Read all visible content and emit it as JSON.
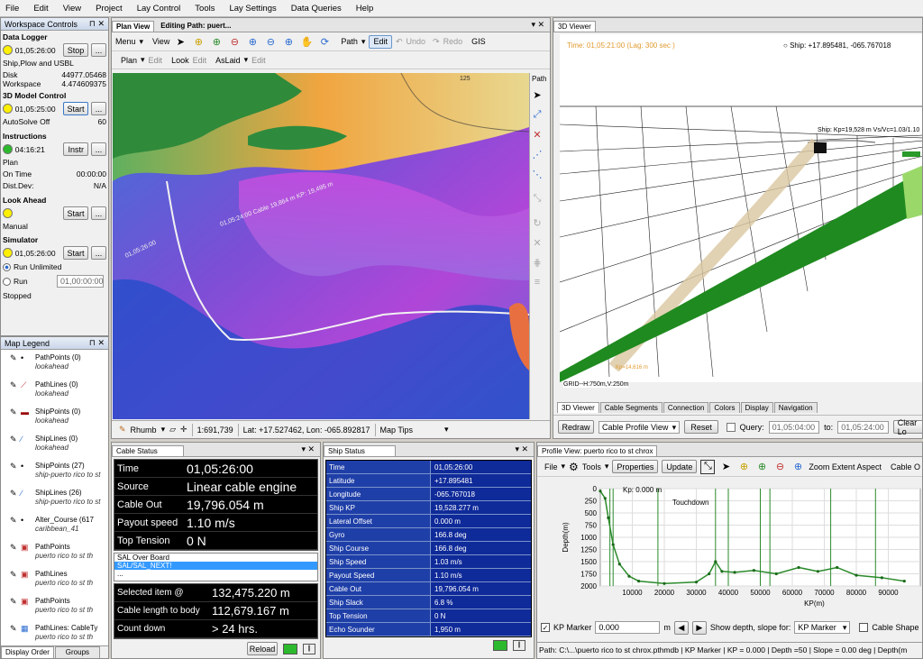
{
  "menu": [
    "File",
    "Edit",
    "View",
    "Project",
    "Lay Control",
    "Tools",
    "Lay Settings",
    "Data Queries",
    "Help"
  ],
  "workspace": {
    "title": "Workspace Controls",
    "data_logger": {
      "title": "Data Logger",
      "time": "01,05:26:00",
      "btn": "Stop",
      "sub": "Ship,Plow and USBL",
      "disk_label": "Disk",
      "disk_value": "44977.05468",
      "ws_label": "Workspace",
      "ws_value": "4.474609375"
    },
    "model": {
      "title": "3D Model Control",
      "time": "01,05:25:00",
      "btn": "Start",
      "autosolve": "AutoSolve Off",
      "autosolve_value": "60"
    },
    "instructions": {
      "title": "Instructions",
      "time": "04:16:21",
      "btn": "Instr",
      "plan": "Plan",
      "ontime": "On Time",
      "ontime_value": "00:00:00",
      "distdev": "Dist.Dev:",
      "distdev_value": "N/A"
    },
    "lookahead": {
      "title": "Look Ahead",
      "btn": "Start",
      "mode": "Manual"
    },
    "simulator": {
      "title": "Simulator",
      "time": "01,05:26:00",
      "btn": "Start",
      "run_unlimited": "Run Unlimited",
      "run": "Run",
      "run_value": "01,00:00:00",
      "status": "Stopped"
    },
    "more": "..."
  },
  "legend": {
    "title": "Map Legend",
    "items": [
      {
        "name": "PathPoints (0)",
        "sub": "lookahead"
      },
      {
        "name": "PathLines (0)",
        "sub": "lookahead"
      },
      {
        "name": "ShipPoints (0)",
        "sub": "lookahead"
      },
      {
        "name": "ShipLines (0)",
        "sub": "lookahead"
      },
      {
        "name": "ShipPoints (27)",
        "sub": "ship-puerto rico to st"
      },
      {
        "name": "ShipLines (26)",
        "sub": "ship-puerto rico to st"
      },
      {
        "name": "Alter_Course (617",
        "sub": "caribbean_41"
      },
      {
        "name": "PathPoints",
        "sub": "puerto rico to st th"
      },
      {
        "name": "PathLines",
        "sub": "puerto rico to st th"
      },
      {
        "name": "PathPoints",
        "sub": "puerto rico to st th"
      },
      {
        "name": "PathLines: CableTy",
        "sub": "puerto rico to st th"
      }
    ],
    "tab1": "Display Order",
    "tab2": "Groups"
  },
  "plan": {
    "tab": "Plan View",
    "editing": "Editing Path: puert...",
    "menu": "Menu",
    "view": "View",
    "path": "Path",
    "edit": "Edit",
    "undo": "Undo",
    "redo": "Redo",
    "gis": "GIS",
    "plan2": "Plan",
    "edit2": "Edit",
    "look": "Look",
    "edit3": "Edit",
    "aslaid": "AsLaid",
    "edit4": "Edit",
    "side": "Path",
    "rhumb": "Rhumb",
    "scale": "1:691,739",
    "latlon": "Lat: +17.527462, Lon: -065.892817",
    "maptips": "Map Tips",
    "label1": "01,05:24:00 Cable 19,864 m KP: 19,495 m",
    "label2": "01,05:26:00",
    "label3": "125"
  },
  "viewer": {
    "tab": "3D Viewer",
    "time": "Time: 01,05:21:00  (Lag: 300 sec )",
    "ship": "Ship: +17.895481, -065.767018",
    "shiplabel": "Ship: Kp=19,528 m Vs/Vc=1.03/1.10",
    "kp": "Kp=14,616 m",
    "grid": "GRID--H:750m,V:250m",
    "tabs": [
      "3D Viewer",
      "Cable Segments",
      "Connection",
      "Colors",
      "Display",
      "Navigation"
    ],
    "redraw": "Redraw",
    "profile": "Cable Profile View",
    "reset": "Reset",
    "query": "Query:",
    "from": "01,05:04:00",
    "to_label": "to:",
    "to": "01,05:24:00",
    "clear": "Clear Lo"
  },
  "cable": {
    "title": "Cable Status",
    "rows": [
      {
        "k": "Time",
        "v": "01,05:26:00"
      },
      {
        "k": "Source",
        "v": "Linear cable engine"
      },
      {
        "k": "Cable Out",
        "v": "19,796.054 m"
      },
      {
        "k": "Payout speed",
        "v": "1.10 m/s"
      },
      {
        "k": "Top Tension",
        "v": "0 N"
      }
    ],
    "list": [
      "SAL Over Board",
      "SAL/SAL_NEXT!",
      "..."
    ],
    "rows2": [
      {
        "k": "Selected item @",
        "v": "132,475.220 m"
      },
      {
        "k": "Cable length to body",
        "v": "112,679.167 m"
      },
      {
        "k": "Count down",
        "v": "> 24 hrs."
      }
    ],
    "reload": "Reload"
  },
  "ship": {
    "title": "Ship Status",
    "rows": [
      {
        "k": "Time",
        "v": "01,05:26:00"
      },
      {
        "k": "Latitude",
        "v": "+17.895481"
      },
      {
        "k": "Longitude",
        "v": "-065.767018"
      },
      {
        "k": "Ship KP",
        "v": "19,528.277 m"
      },
      {
        "k": "Lateral Offset",
        "v": "0.000 m"
      },
      {
        "k": "Gyro",
        "v": "166.8 deg"
      },
      {
        "k": "Ship Course",
        "v": "166.8 deg"
      },
      {
        "k": "Ship Speed",
        "v": "1.03 m/s"
      },
      {
        "k": "Payout Speed",
        "v": "1.10 m/s"
      },
      {
        "k": "Cable Out",
        "v": "19,796.054 m"
      },
      {
        "k": "Ship Slack",
        "v": "6.8 %"
      },
      {
        "k": "Top Tension",
        "v": "0 N"
      },
      {
        "k": "Echo Sounder",
        "v": "1,950 m"
      }
    ]
  },
  "profile": {
    "tab": "Profile View: puerto rico to st chrox",
    "file": "File",
    "tools": "Tools",
    "properties": "Properties",
    "update": "Update",
    "zoom": "Zoom Extent Aspect",
    "cableo": "Cable O",
    "kp": "Kp: 0.000 m",
    "touchdown": "Touchdown",
    "ylabel": "Depth(m)",
    "xlabel": "KP(m)",
    "yticks": [
      "0",
      "250",
      "500",
      "750",
      "1000",
      "1250",
      "1500",
      "1750",
      "2000"
    ],
    "xticks": [
      "10000",
      "20000",
      "30000",
      "40000",
      "50000",
      "60000",
      "70000",
      "80000",
      "90000"
    ],
    "kpmarker": "KP Marker",
    "kpvalue": "0.000",
    "unit": "m",
    "showdepth": "Show depth, slope for:",
    "kpsel": "KP Marker",
    "cableshape": "Cable Shape",
    "status": "Path: C:\\...\\puerto rico to st chrox.pthmdb | KP Marker | KP = 0.000 | Depth =50 | Slope = 0.00 deg | Depth(m"
  }
}
